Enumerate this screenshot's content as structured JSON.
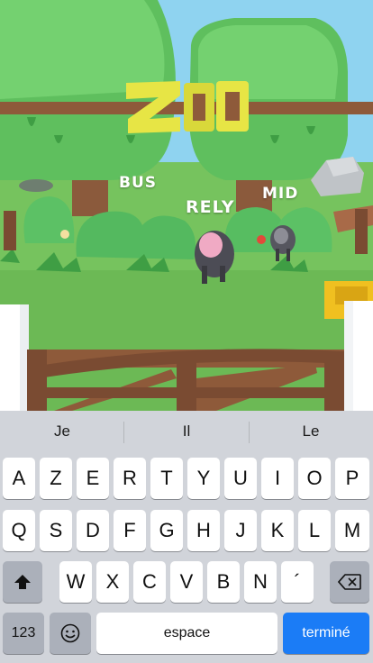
{
  "game": {
    "sign_text": "ZOO",
    "name_tags": [
      "BUS",
      "RELY",
      "MID"
    ]
  },
  "keyboard": {
    "suggestions": [
      "Je",
      "Il",
      "Le"
    ],
    "row1": [
      "A",
      "Z",
      "E",
      "R",
      "T",
      "Y",
      "U",
      "I",
      "O",
      "P"
    ],
    "row2": [
      "Q",
      "S",
      "D",
      "F",
      "G",
      "H",
      "J",
      "K",
      "L",
      "M"
    ],
    "row3": [
      "W",
      "X",
      "C",
      "V",
      "B",
      "N",
      "´"
    ],
    "numbers_label": "123",
    "space_label": "espace",
    "done_label": "terminé",
    "shift_icon": "shift-arrow-icon",
    "delete_icon": "backspace-icon",
    "emoji_icon": "emoji-icon",
    "accent_color": "#1b7cf6"
  }
}
